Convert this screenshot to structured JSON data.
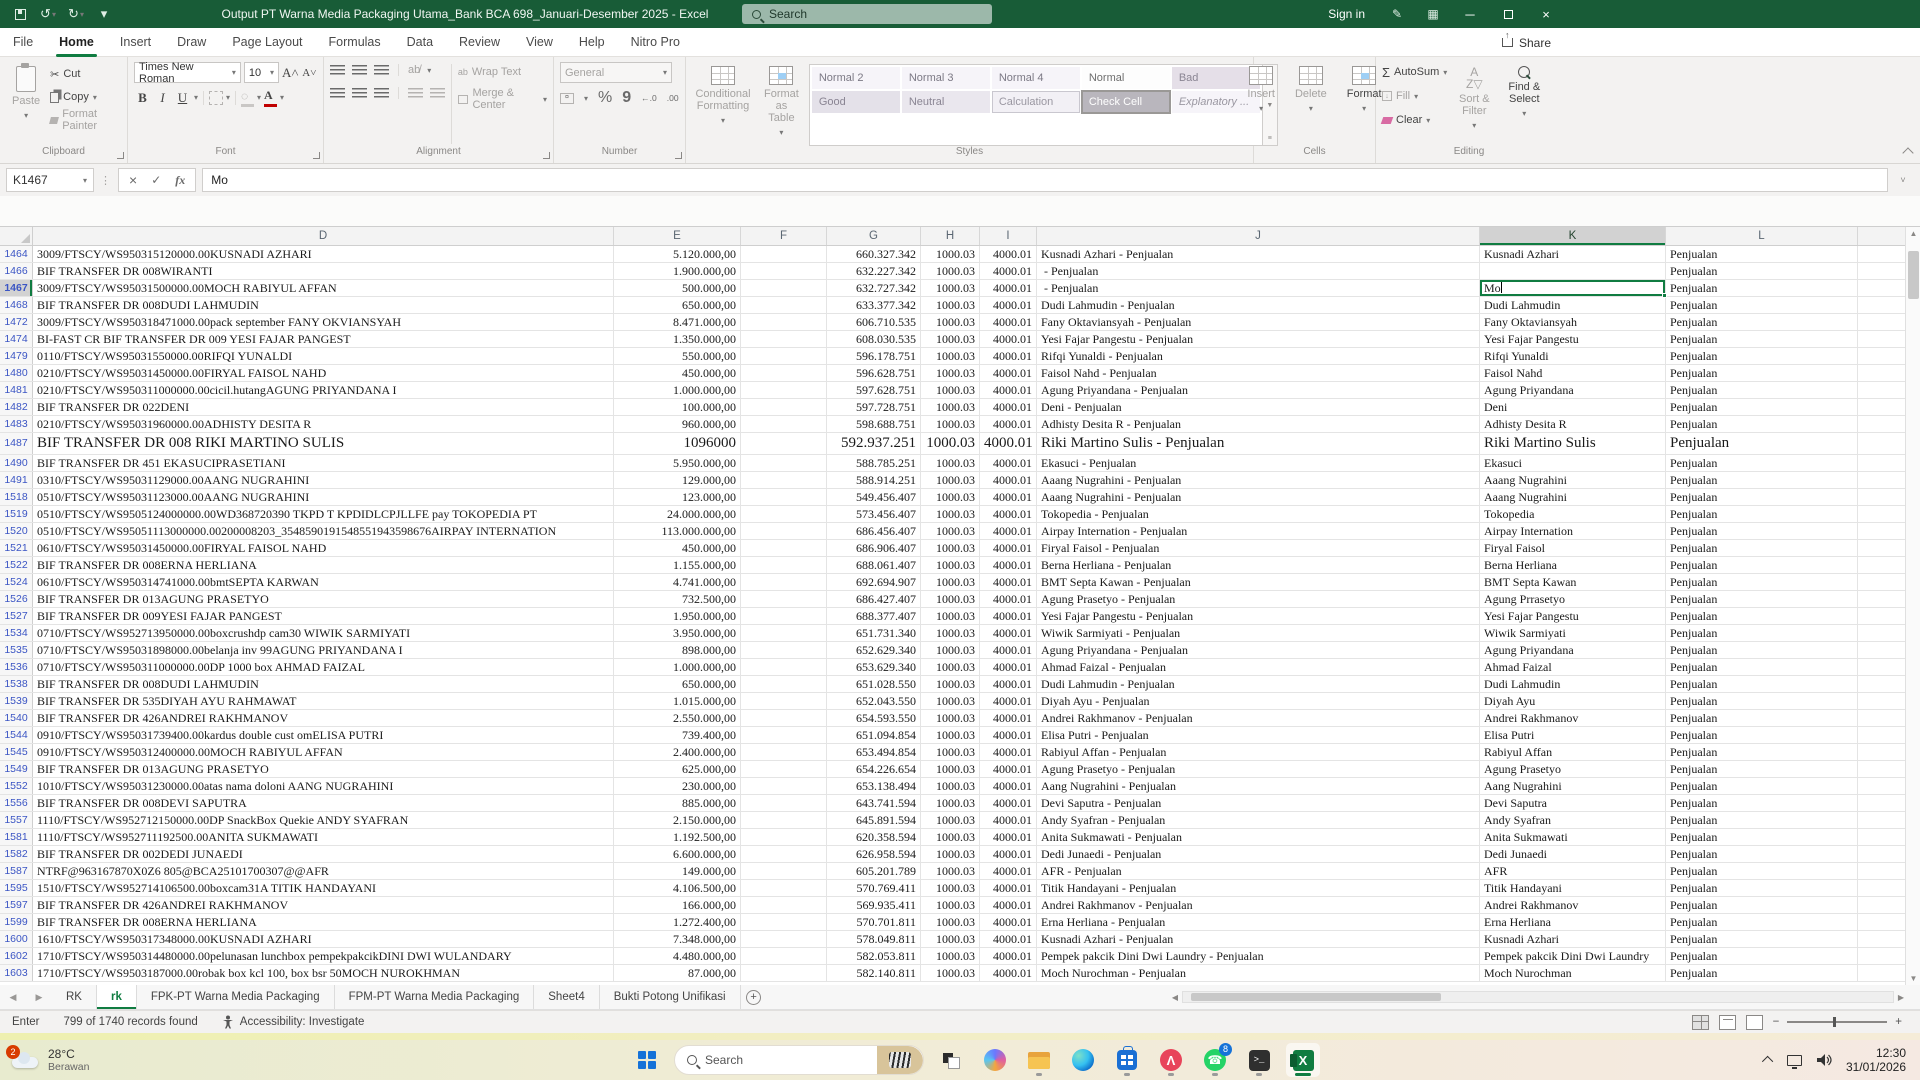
{
  "title_bar": {
    "title": "Output PT Warna Media Packaging Utama_Bank BCA 698_Januari-Desember 2025  -  Excel",
    "search_placeholder": "Search",
    "sign_in": "Sign in"
  },
  "icons": {
    "undo": "↺",
    "redo": "↻",
    "close": "×",
    "minimize": "─"
  },
  "ribbon_tabs": [
    "File",
    "Home",
    "Insert",
    "Draw",
    "Page Layout",
    "Formulas",
    "Data",
    "Review",
    "View",
    "Help",
    "Nitro Pro"
  ],
  "active_tab": "Home",
  "share_label": "Share",
  "ribbon": {
    "clipboard": {
      "paste": "Paste",
      "cut": "Cut",
      "copy": "Copy",
      "format_painter": "Format Painter",
      "label": "Clipboard"
    },
    "font": {
      "name": "Times New Roman",
      "size": "10",
      "bold": "B",
      "italic": "I",
      "underline": "U",
      "grow": "A^",
      "shrink": "Av",
      "label": "Font"
    },
    "alignment": {
      "wrap_text": "Wrap Text",
      "merge_center": "Merge & Center",
      "label": "Alignment"
    },
    "number": {
      "format": "General",
      "percent": "%",
      "comma": "9",
      "inc_decimal": "←.0",
      "dec_decimal": ".00",
      "label": "Number"
    },
    "styles": {
      "conditional_formatting": "Conditional Formatting",
      "format_as_table": "Format as Table",
      "row1": [
        "Normal 2",
        "Normal 3",
        "Normal 4",
        "Normal",
        "Bad"
      ],
      "row2": [
        "Good",
        "Neutral",
        "Calculation",
        "Check Cell",
        "Explanatory ..."
      ],
      "selected": "Check Cell",
      "label": "Styles"
    },
    "cells": {
      "insert": "Insert",
      "delete": "Delete",
      "format": "Format",
      "label": "Cells"
    },
    "editing": {
      "autosum": "AutoSum",
      "fill": "Fill",
      "clear": "Clear",
      "sort_filter": "Sort & Filter",
      "find_select": "Find & Select",
      "label": "Editing"
    },
    "group_labels": [
      "Clipboard",
      "Font",
      "Alignment",
      "Number",
      "Styles",
      "Cells",
      "Editing"
    ]
  },
  "formula_bar": {
    "name_box": "K1467",
    "cancel": "×",
    "enter": "✓",
    "fx": "fx",
    "content": "Mo"
  },
  "grid": {
    "columns": [
      "D",
      "E",
      "F",
      "G",
      "H",
      "I",
      "J",
      "K",
      "L"
    ],
    "selected_column": "K",
    "selected_row": "1467",
    "h_all": "1000.03",
    "i_all": "4000.01",
    "l_all": "Penjualan",
    "rows": [
      {
        "row": "1464",
        "d": "3009/FTSCY/WS950315120000.00KUSNADI AZHARI",
        "e": "5.120.000,00",
        "g": "660.327.342",
        "j": "Kusnadi Azhari - Penjualan",
        "k": "Kusnadi Azhari"
      },
      {
        "row": "1466",
        "d": "BIF TRANSFER DR 008WIRANTI",
        "e": "1.900.000,00",
        "g": "632.227.342",
        "j": " - Penjualan",
        "k": ""
      },
      {
        "row": "1467",
        "d": "3009/FTSCY/WS95031500000.00MOCH RABIYUL AFFAN",
        "e": "500.000,00",
        "g": "632.727.342",
        "j": " - Penjualan",
        "k": "Mo",
        "active": true
      },
      {
        "row": "1468",
        "d": "BIF TRANSFER DR 008DUDI LAHMUDIN",
        "e": "650.000,00",
        "g": "633.377.342",
        "j": "Dudi Lahmudin - Penjualan",
        "k": "Dudi Lahmudin"
      },
      {
        "row": "1472",
        "d": "3009/FTSCY/WS950318471000.00pack september FANY OKVIANSYAH",
        "e": "8.471.000,00",
        "g": "606.710.535",
        "j": "Fany Oktaviansyah - Penjualan",
        "k": "Fany Oktaviansyah"
      },
      {
        "row": "1474",
        "d": "BI-FAST CR BIF TRANSFER DR 009 YESI FAJAR PANGEST",
        "e": "1.350.000,00",
        "g": "608.030.535",
        "j": "Yesi Fajar Pangestu - Penjualan",
        "k": "Yesi Fajar Pangestu"
      },
      {
        "row": "1479",
        "d": "0110/FTSCY/WS95031550000.00RIFQI YUNALDI",
        "e": "550.000,00",
        "g": "596.178.751",
        "j": "Rifqi Yunaldi - Penjualan",
        "k": "Rifqi Yunaldi"
      },
      {
        "row": "1480",
        "d": "0210/FTSCY/WS95031450000.00FIRYAL FAISOL NAHD",
        "e": "450.000,00",
        "g": "596.628.751",
        "j": "Faisol Nahd - Penjualan",
        "k": "Faisol Nahd"
      },
      {
        "row": "1481",
        "d": "0210/FTSCY/WS950311000000.00cicil.hutangAGUNG PRIYANDANA I",
        "e": "1.000.000,00",
        "g": "597.628.751",
        "j": "Agung Priyandana - Penjualan",
        "k": "Agung Priyandana"
      },
      {
        "row": "1482",
        "d": "BIF TRANSFER DR 022DENI",
        "e": "100.000,00",
        "g": "597.728.751",
        "j": "Deni - Penjualan",
        "k": "Deni"
      },
      {
        "row": "1483",
        "d": "0210/FTSCY/WS95031960000.00ADHISTY DESITA R",
        "e": "960.000,00",
        "g": "598.688.751",
        "j": "Adhisty Desita R - Penjualan",
        "k": "Adhisty Desita R"
      },
      {
        "row": "1487",
        "d": "BIF TRANSFER DR 008 RIKI MARTINO SULIS",
        "e": "1096000",
        "g": "592.937.251",
        "j": "Riki Martino Sulis - Penjualan",
        "k": "Riki Martino Sulis",
        "big": true
      },
      {
        "row": "1490",
        "d": "BIF TRANSFER DR 451 EKASUCIPRASETIANI",
        "e": "5.950.000,00",
        "g": "588.785.251",
        "j": "Ekasuci - Penjualan",
        "k": "Ekasuci"
      },
      {
        "row": "1491",
        "d": "0310/FTSCY/WS95031129000.00AANG NUGRAHINI",
        "e": "129.000,00",
        "g": "588.914.251",
        "j": "Aaang Nugrahini - Penjualan",
        "k": "Aaang Nugrahini"
      },
      {
        "row": "1518",
        "d": "0510/FTSCY/WS95031123000.00AANG NUGRAHINI",
        "e": "123.000,00",
        "g": "549.456.407",
        "j": "Aaang Nugrahini - Penjualan",
        "k": "Aaang Nugrahini"
      },
      {
        "row": "1519",
        "d": "0510/FTSCY/WS9505124000000.00WD368720390 TKPD T KPDIDLCPJLLFE pay TOKOPEDIA PT",
        "e": "24.000.000,00",
        "g": "573.456.407",
        "j": "Tokopedia - Penjualan",
        "k": "Tokopedia"
      },
      {
        "row": "1520",
        "d": "0510/FTSCY/WS95051113000000.00200008203_3548590191548551943598676AIRPAY INTERNATION",
        "e": "113.000.000,00",
        "g": "686.456.407",
        "j": "Airpay Internation - Penjualan",
        "k": "Airpay Internation"
      },
      {
        "row": "1521",
        "d": "0610/FTSCY/WS95031450000.00FIRYAL FAISOL NAHD",
        "e": "450.000,00",
        "g": "686.906.407",
        "j": "Firyal Faisol - Penjualan",
        "k": "Firyal Faisol"
      },
      {
        "row": "1522",
        "d": "BIF TRANSFER DR 008ERNA HERLIANA",
        "e": "1.155.000,00",
        "g": "688.061.407",
        "j": "Berna Herliana - Penjualan",
        "k": "Berna Herliana"
      },
      {
        "row": "1524",
        "d": "0610/FTSCY/WS950314741000.00bmtSEPTA KARWAN",
        "e": "4.741.000,00",
        "g": "692.694.907",
        "j": "BMT Septa Kawan - Penjualan",
        "k": "BMT Septa Kawan"
      },
      {
        "row": "1526",
        "d": "BIF TRANSFER DR 013AGUNG PRASETYO",
        "e": "732.500,00",
        "g": "686.427.407",
        "j": "Agung Prasetyo - Penjualan",
        "k": "Agung Prrasetyo"
      },
      {
        "row": "1527",
        "d": "BIF TRANSFER DR 009YESI FAJAR PANGEST",
        "e": "1.950.000,00",
        "g": "688.377.407",
        "j": "Yesi Fajar Pangestu - Penjualan",
        "k": "Yesi Fajar Pangestu"
      },
      {
        "row": "1534",
        "d": "0710/FTSCY/WS952713950000.00boxcrushdp cam30 WIWIK SARMIYATI",
        "e": "3.950.000,00",
        "g": "651.731.340",
        "j": "Wiwik Sarmiyati - Penjualan",
        "k": "Wiwik Sarmiyati"
      },
      {
        "row": "1535",
        "d": "0710/FTSCY/WS95031898000.00belanja inv 99AGUNG PRIYANDANA I",
        "e": "898.000,00",
        "g": "652.629.340",
        "j": "Agung Priyandana - Penjualan",
        "k": "Agung Priyandana"
      },
      {
        "row": "1536",
        "d": "0710/FTSCY/WS950311000000.00DP 1000 box AHMAD FAIZAL",
        "e": "1.000.000,00",
        "g": "653.629.340",
        "j": "Ahmad Faizal - Penjualan",
        "k": "Ahmad Faizal"
      },
      {
        "row": "1538",
        "d": "BIF TRANSFER DR 008DUDI LAHMUDIN",
        "e": "650.000,00",
        "g": "651.028.550",
        "j": "Dudi Lahmudin - Penjualan",
        "k": "Dudi Lahmudin"
      },
      {
        "row": "1539",
        "d": "BIF TRANSFER DR 535DIYAH AYU RAHMAWAT",
        "e": "1.015.000,00",
        "g": "652.043.550",
        "j": "Diyah Ayu - Penjualan",
        "k": "Diyah Ayu"
      },
      {
        "row": "1540",
        "d": "BIF TRANSFER DR 426ANDREI RAKHMANOV",
        "e": "2.550.000,00",
        "g": "654.593.550",
        "j": "Andrei Rakhmanov - Penjualan",
        "k": "Andrei Rakhmanov"
      },
      {
        "row": "1544",
        "d": "0910/FTSCY/WS95031739400.00kardus double cust omELISA PUTRI",
        "e": "739.400,00",
        "g": "651.094.854",
        "j": "Elisa Putri - Penjualan",
        "k": "Elisa Putri"
      },
      {
        "row": "1545",
        "d": "0910/FTSCY/WS950312400000.00MOCH RABIYUL AFFAN",
        "e": "2.400.000,00",
        "g": "653.494.854",
        "j": "Rabiyul Affan - Penjualan",
        "k": "Rabiyul Affan"
      },
      {
        "row": "1549",
        "d": "BIF TRANSFER DR 013AGUNG PRASETYO",
        "e": "625.000,00",
        "g": "654.226.654",
        "j": "Agung Prasetyo - Penjualan",
        "k": "Agung Prasetyo"
      },
      {
        "row": "1552",
        "d": "1010/FTSCY/WS95031230000.00atas nama doloni AANG NUGRAHINI",
        "e": "230.000,00",
        "g": "653.138.494",
        "j": "Aang Nugrahini - Penjualan",
        "k": "Aang Nugrahini"
      },
      {
        "row": "1556",
        "d": "BIF TRANSFER DR 008DEVI SAPUTRA",
        "e": "885.000,00",
        "g": "643.741.594",
        "j": "Devi Saputra - Penjualan",
        "k": "Devi Saputra"
      },
      {
        "row": "1557",
        "d": "1110/FTSCY/WS952712150000.00DP SnackBox Quekie ANDY SYAFRAN",
        "e": "2.150.000,00",
        "g": "645.891.594",
        "j": "Andy Syafran - Penjualan",
        "k": "Andy Syafran"
      },
      {
        "row": "1581",
        "d": "1110/FTSCY/WS952711192500.00ANITA SUKMAWATI",
        "e": "1.192.500,00",
        "g": "620.358.594",
        "j": "Anita Sukmawati - Penjualan",
        "k": "Anita Sukmawati"
      },
      {
        "row": "1582",
        "d": "BIF TRANSFER DR 002DEDI JUNAEDI",
        "e": "6.600.000,00",
        "g": "626.958.594",
        "j": "Dedi Junaedi - Penjualan",
        "k": "Dedi Junaedi"
      },
      {
        "row": "1587",
        "d": "NTRF@963167870X0Z6 805@BCA25101700307@@AFR",
        "e": "149.000,00",
        "g": "605.201.789",
        "j": "AFR - Penjualan",
        "k": "AFR"
      },
      {
        "row": "1595",
        "d": "1510/FTSCY/WS952714106500.00boxcam31A TITIK HANDAYANI",
        "e": "4.106.500,00",
        "g": "570.769.411",
        "j": "Titik Handayani - Penjualan",
        "k": "Titik Handayani"
      },
      {
        "row": "1597",
        "d": "BIF TRANSFER DR 426ANDREI RAKHMANOV",
        "e": "166.000,00",
        "g": "569.935.411",
        "j": "Andrei Rakhmanov - Penjualan",
        "k": "Andrei Rakhmanov"
      },
      {
        "row": "1599",
        "d": "BIF TRANSFER DR 008ERNA HERLIANA",
        "e": "1.272.400,00",
        "g": "570.701.811",
        "j": "Erna Herliana - Penjualan",
        "k": "Erna Herliana"
      },
      {
        "row": "1600",
        "d": "1610/FTSCY/WS950317348000.00KUSNADI AZHARI",
        "e": "7.348.000,00",
        "g": "578.049.811",
        "j": "Kusnadi Azhari - Penjualan",
        "k": "Kusnadi Azhari"
      },
      {
        "row": "1602",
        "d": "1710/FTSCY/WS950314480000.00pelunasan lunchbox pempekpakcikDINI DWI WULANDARY",
        "e": "4.480.000,00",
        "g": "582.053.811",
        "j": "Pempek pakcik Dini Dwi Laundry - Penjualan",
        "k": "Pempek pakcik Dini Dwi Laundry"
      },
      {
        "row": "1603",
        "d": "1710/FTSCY/WS9503187000.00robak box kcl 100, box bsr 50MOCH NUROKHMAN",
        "e": "87.000,00",
        "g": "582.140.811",
        "j": "Moch Nurochman - Penjualan",
        "k": "Moch Nurochman"
      }
    ]
  },
  "sheet_tabs": {
    "tabs": [
      "RK",
      "rk",
      "FPK-PT Warna Media Packaging",
      "FPM-PT Warna Media Packaging",
      "Sheet4",
      "Bukti Potong Unifikasi"
    ],
    "active": "rk"
  },
  "status_bar": {
    "mode": "Enter",
    "records": "799 of 1740 records found",
    "accessibility": "Accessibility: Investigate"
  },
  "taskbar": {
    "weather_temp": "28°C",
    "weather_desc": "Berawan",
    "weather_badge": "2",
    "search_placeholder": "Search",
    "whatsapp_badge": "8",
    "time": "12:30",
    "date": "31/01/2026"
  },
  "colors": {
    "titlebar_green": "#185c37",
    "accent_green": "#107C41",
    "filtered_row_number_blue": "#3b55c4",
    "whatsapp_green": "#25D366",
    "badge_red": "#d83b01"
  }
}
